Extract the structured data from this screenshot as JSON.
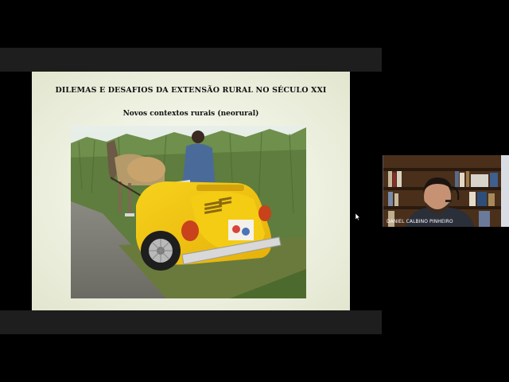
{
  "presentation": {
    "title": "DILEMAS E DESAFIOS DA EXTENSÃO RURAL NO SÉCULO XXI",
    "subtitle": "Novos contextos rurais (neorural)"
  },
  "participant": {
    "name": "DANIEL CALBINO PINHEIRO"
  },
  "colors": {
    "background": "#000000",
    "slide_background": "#e9ecd9",
    "car_yellow": "#f2c40f"
  },
  "icons": [
    "mouse-cursor-icon"
  ]
}
